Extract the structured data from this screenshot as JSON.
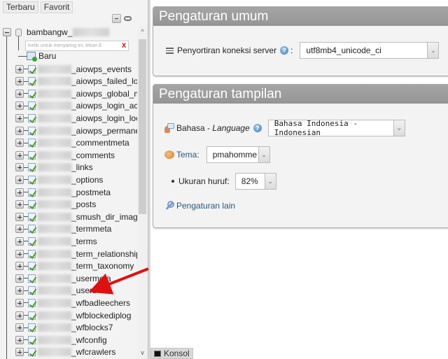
{
  "nav": {
    "tabs": [
      "Terbaru",
      "Favorit"
    ],
    "database": {
      "name": "bambangw_",
      "filter_placeholder": "Ketik untuk menyaring ini, tekan E",
      "filter_clear": "X",
      "new_label": "Baru",
      "tables": [
        "_aiowps_events",
        "_aiowps_failed_logins",
        "_aiowps_global_meta",
        "_aiowps_login_activity",
        "_aiowps_login_lockdo",
        "_aiowps_permanent_b",
        "_commentmeta",
        "_comments",
        "_links",
        "_options",
        "_postmeta",
        "_posts",
        "_smush_dir_images",
        "_termmeta",
        "_terms",
        "_term_relationships",
        "_term_taxonomy",
        "_usermeta",
        "_users",
        "_wfbadleechers",
        "_wfblockediplog",
        "_wfblocks7",
        "_wfconfig",
        "_wfcrawlers"
      ]
    },
    "scroll_up": "^",
    "scroll_down": "v"
  },
  "console": {
    "label": "Konsol"
  },
  "general_settings": {
    "title": "Pengaturan umum",
    "collation_label": "Penyortiran koneksi server",
    "collation_value": "utf8mb4_unicode_ci",
    "help": "?"
  },
  "appearance_settings": {
    "title": "Pengaturan tampilan",
    "language_label_prefix": "Bahasa - ",
    "language_label_italic": "Language",
    "language_value": "Bahasa Indonesia - Indonesian",
    "theme_label": "Tema:",
    "theme_value": "pmahomme",
    "font_size_label": "Ukuran huruf:",
    "font_size_value": "82%",
    "more_settings_link": "Pengaturan lain",
    "help": "?"
  },
  "annotation": {
    "arrow_color": "#e01010",
    "arrow_target": "_users"
  },
  "colors": {
    "header_bg": "#9e9e9e",
    "link": "#235a81"
  }
}
